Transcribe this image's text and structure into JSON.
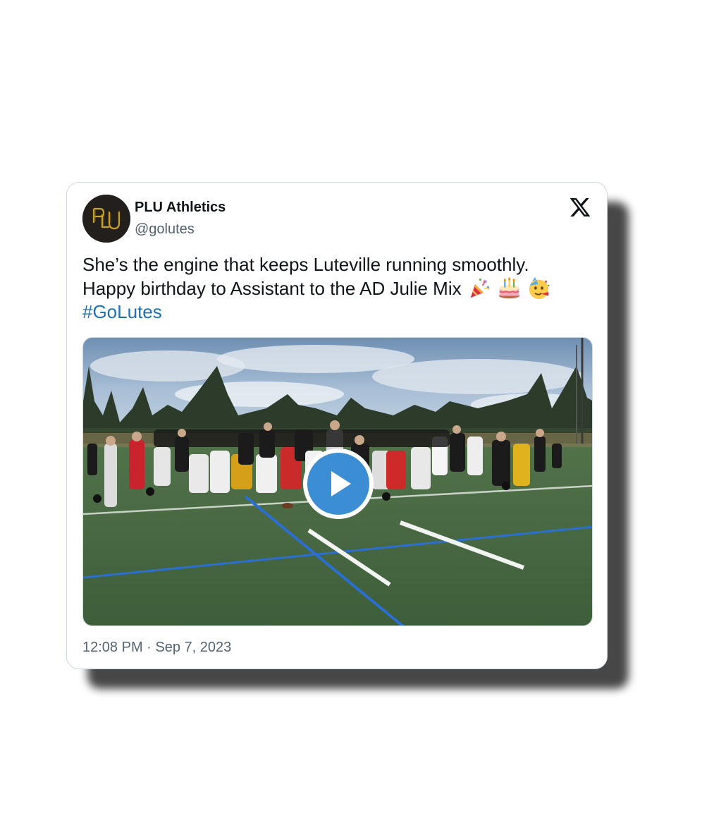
{
  "tweet": {
    "display_name": "PLU Athletics",
    "handle": "@golutes",
    "avatar_icon": "plu-monogram-logo",
    "text_lines": [
      "She’s the engine that keeps Luteville running smoothly.",
      "Happy birthday to Assistant to the AD Julie Mix"
    ],
    "emojis": [
      "party-popper-icon",
      "birthday-cake-icon",
      "partying-face-icon"
    ],
    "hashtag": "#GoLutes",
    "timestamp": "12:08 PM · Sep 7, 2023"
  },
  "media": {
    "type": "video",
    "play_icon": "play-icon"
  },
  "brand": {
    "platform_icon": "x-logo-icon"
  },
  "colors": {
    "text": "#0f1419",
    "secondary": "#536471",
    "link": "#1d70b8",
    "play": "#3c8ed4",
    "avatar_bg": "#231f1c",
    "logo_gold": "#c9a227"
  }
}
